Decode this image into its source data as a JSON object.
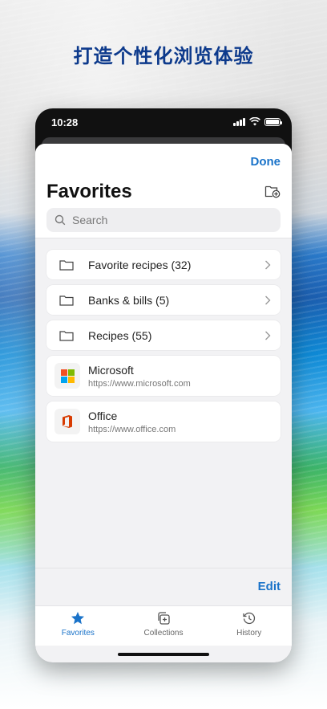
{
  "headline": "打造个性化浏览体验",
  "status_bar": {
    "time": "10:28"
  },
  "header": {
    "done_label": "Done",
    "title": "Favorites"
  },
  "search": {
    "placeholder": "Search"
  },
  "folders": [
    {
      "label": "Favorite recipes (32)"
    },
    {
      "label": "Banks & bills (5)"
    },
    {
      "label": "Recipes (55)"
    }
  ],
  "sites": [
    {
      "name": "Microsoft",
      "url": "https://www.microsoft.com",
      "icon": "microsoft-logo"
    },
    {
      "name": "Office",
      "url": "https://www.office.com",
      "icon": "office-logo"
    }
  ],
  "footer": {
    "edit_label": "Edit"
  },
  "tabs": [
    {
      "label": "Favorites",
      "icon": "star-icon",
      "active": true
    },
    {
      "label": "Collections",
      "icon": "collections-icon",
      "active": false
    },
    {
      "label": "History",
      "icon": "history-icon",
      "active": false
    }
  ],
  "colors": {
    "accent": "#1a73c9",
    "headline": "#0d3a8c",
    "ms_red": "#f25022",
    "ms_green": "#7fba00",
    "ms_blue": "#00a4ef",
    "ms_yellow": "#ffb900",
    "office_red": "#d83b01"
  }
}
